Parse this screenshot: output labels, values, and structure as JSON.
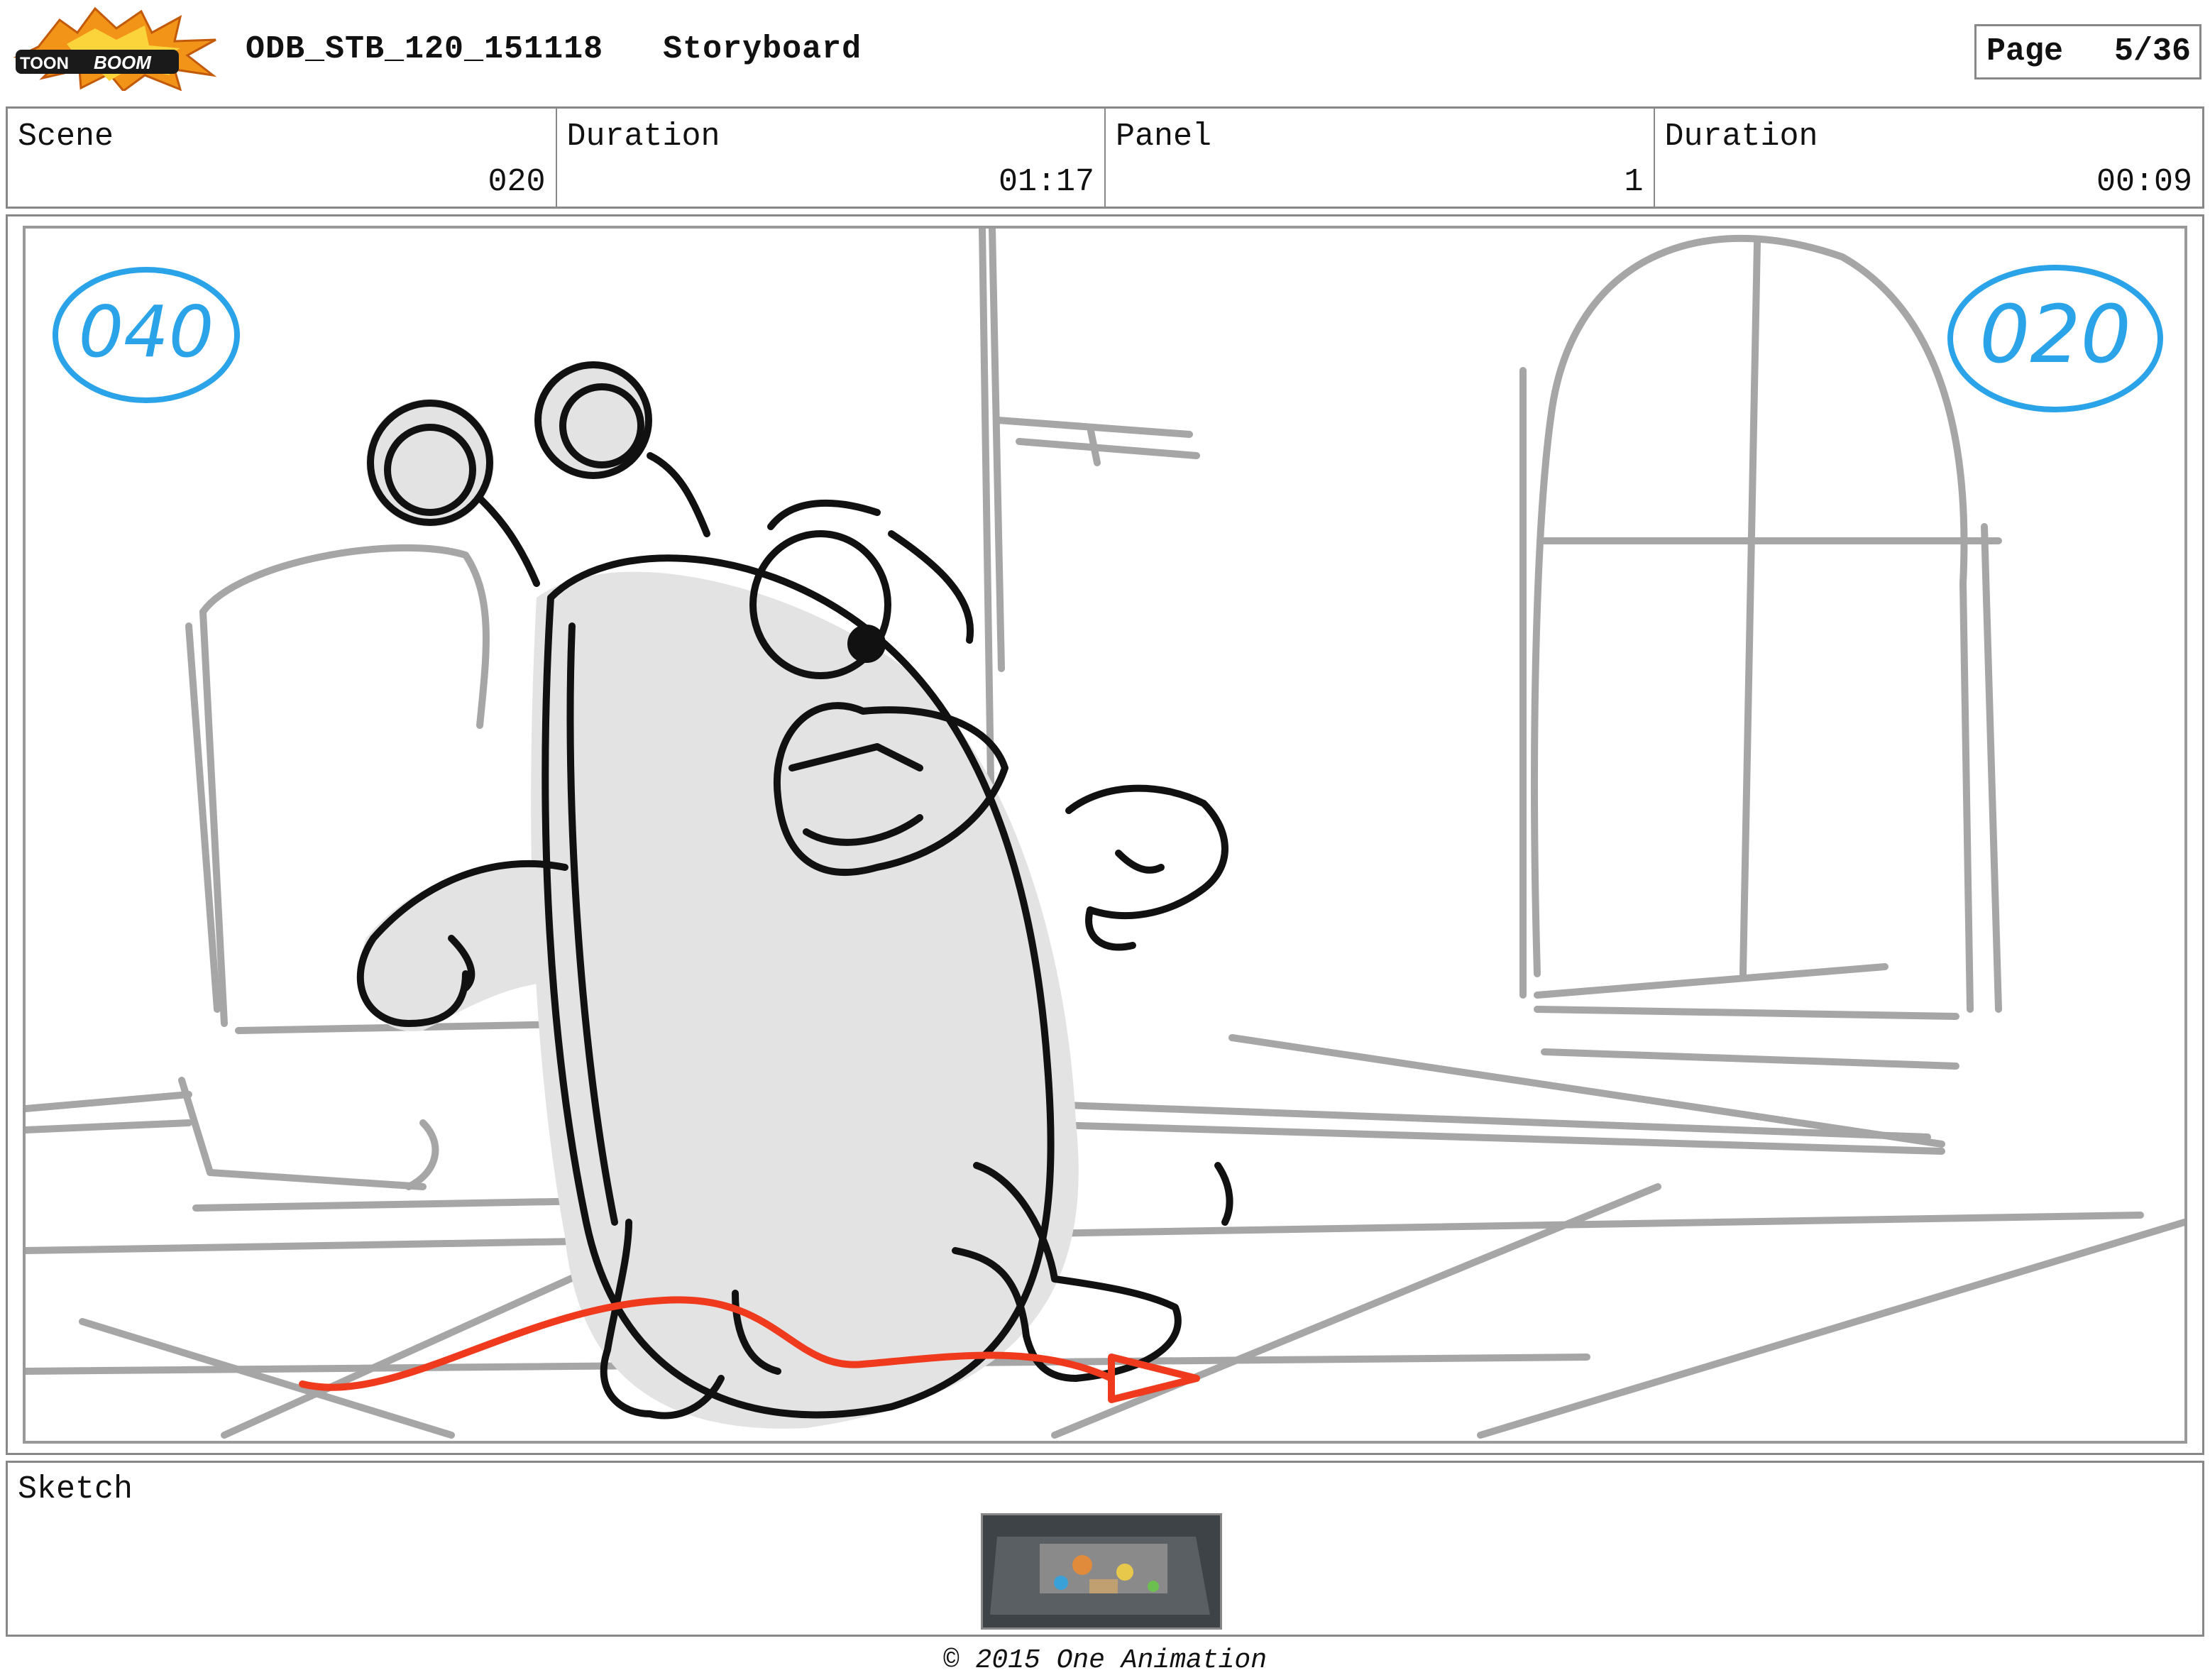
{
  "header": {
    "logo_text": "TOONBOOM",
    "title": "ODB_STB_120_151118   Storyboard",
    "page_label": "Page",
    "page_value": "5/36"
  },
  "info": {
    "scene_label": "Scene",
    "scene_value": "020",
    "scene_duration_label": "Duration",
    "scene_duration_value": "01:17",
    "panel_label": "Panel",
    "panel_value": "1",
    "panel_duration_label": "Duration",
    "panel_duration_value": "00:09"
  },
  "panel": {
    "left_marker": "040",
    "right_marker": "020",
    "marker_color": "#2aa3e8",
    "motion_arrow_color": "#f03a1e"
  },
  "sketch": {
    "label": "Sketch"
  },
  "footer": {
    "copyright": "© 2015 One Animation"
  }
}
